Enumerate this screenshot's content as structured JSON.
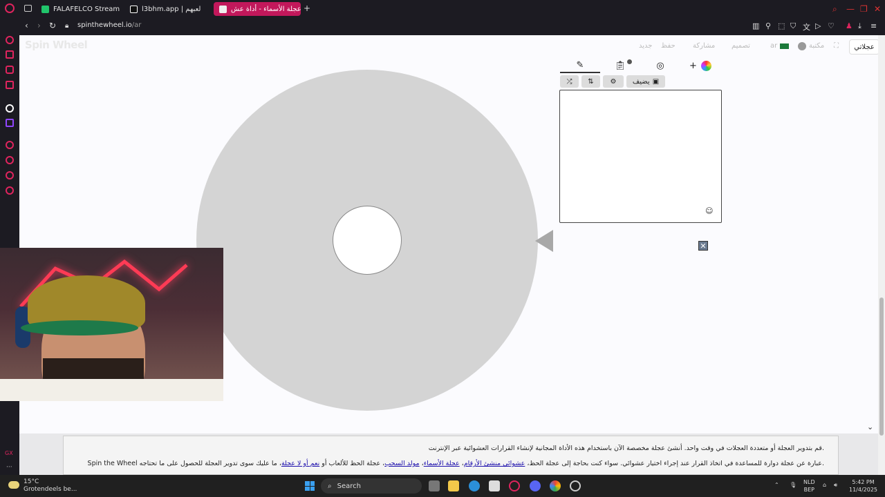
{
  "tabs": [
    {
      "label": "FALAFELCO Stream - Wat",
      "color": "#21c46b"
    },
    {
      "label": "l3bhm.app | لعبهم",
      "color": "#111111"
    },
    {
      "label": "برنامج عجلة الأسماء - أداة عش",
      "color": "#e5e5e5"
    }
  ],
  "new_tab": "+",
  "url": {
    "host": "spinthewheel.io",
    "path": "/ar"
  },
  "site": {
    "logo": "Spin Wheel",
    "menu": {
      "new": "جديد",
      "save": "حفظ",
      "share": "مشاركة",
      "design": "تصميم",
      "lang": "ar",
      "gallery": "مكتبة"
    },
    "my_wheels": "عجلاتي"
  },
  "panel": {
    "tab_icons": [
      "pencil-icon",
      "clipboard-icon",
      "eye-off-icon",
      "color-wheel-icon"
    ],
    "plus": "+",
    "add_label": "يضيف",
    "entries_value": "",
    "emoji": "☺",
    "close": "✕"
  },
  "info": {
    "line1": ".قم بتدوير العجلة أو متعددة العجلات في وقت واحد. أنشئ عجلة مخصصة الآن باستخدام هذه الأداة المجانية لإنشاء القرارات العشوائية عبر الإنترنت",
    "line2_pre": ".عبارة عن عجلة دوارة للمساعدة في اتخاذ القرار عند إجراء اختيار عشوائي. سواء كنت بحاجة إلى عجلة الحظ،",
    "link1": "عشوائي منشئ الأرقام",
    "link2": "عجلة الأسماء",
    "link3": "مولد السحب",
    "mid": "، عجلة الحظ للألعاب أو",
    "link4": "نعم أو لا عجلة",
    "tail": "، ما عليك سوى تدوير العجلة للحصول على ما تحتاجه Spin the Wheel"
  },
  "taskbar": {
    "temp": "15°C",
    "weather": "Grotendeels be...",
    "search": "Search",
    "lang1": "NLD",
    "lang2": "BEP",
    "time": "5:42 PM",
    "date": "11/4/2025"
  }
}
